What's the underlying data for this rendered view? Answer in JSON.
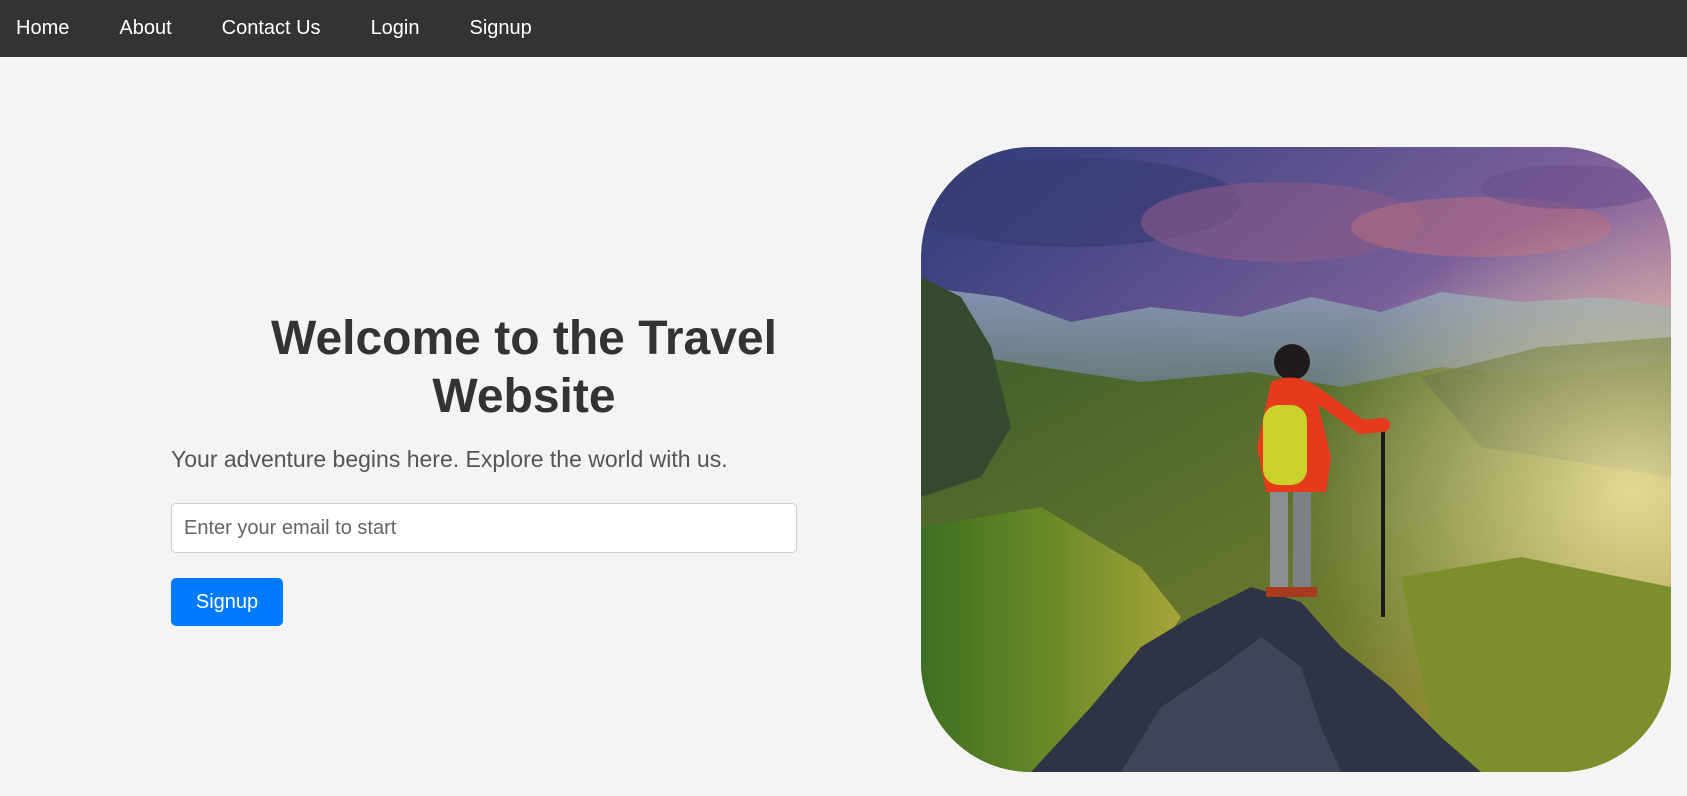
{
  "nav": {
    "items": [
      {
        "label": "Home"
      },
      {
        "label": "About"
      },
      {
        "label": "Contact Us"
      },
      {
        "label": "Login"
      },
      {
        "label": "Signup"
      }
    ]
  },
  "hero": {
    "title": "Welcome to the Travel Website",
    "subtitle": "Your adventure begins here. Explore the world with us.",
    "email_placeholder": "Enter your email to start",
    "email_value": "",
    "signup_label": "Signup"
  },
  "image": {
    "alt": "hiker-on-mountain-photo"
  },
  "colors": {
    "navbar": "#333333",
    "background": "#f4f4f4",
    "accent": "#007bff",
    "title": "#333333",
    "subtitle": "#555555"
  }
}
